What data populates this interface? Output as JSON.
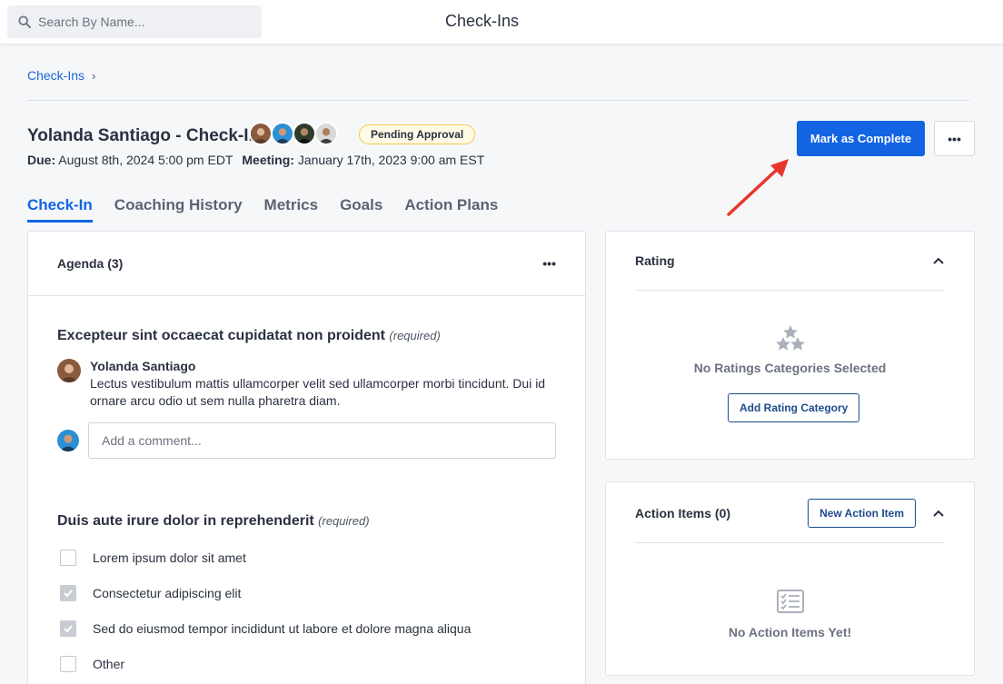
{
  "topbar": {
    "search_placeholder": "Search By Name...",
    "title": "Check-Ins"
  },
  "breadcrumb": {
    "root": "Check-Ins",
    "separator": "›"
  },
  "header": {
    "title": "Yolanda Santiago - Check-In",
    "badge": "Pending Approval",
    "due_label": "Due:",
    "due_value": "August 8th, 2024 5:00 pm EDT",
    "meeting_label": "Meeting:",
    "meeting_value": "January 17th, 2023 9:00 am EST",
    "primary_button": "Mark as Complete",
    "more_button": "•••"
  },
  "tabs": [
    {
      "label": "Check-In",
      "active": true
    },
    {
      "label": "Coaching History",
      "active": false
    },
    {
      "label": "Metrics",
      "active": false
    },
    {
      "label": "Goals",
      "active": false
    },
    {
      "label": "Action Plans",
      "active": false
    }
  ],
  "agenda": {
    "title": "Agenda (3)",
    "more": "•••",
    "questions": [
      {
        "title": "Excepteur sint occaecat cupidatat non proident",
        "required": "(required)",
        "comment_author": "Yolanda Santiago",
        "comment_text": "Lectus vestibulum mattis ullamcorper velit sed ullamcorper morbi tincidunt. Dui id ornare arcu odio ut sem nulla pharetra diam.",
        "add_comment_placeholder": "Add a comment..."
      },
      {
        "title": "Duis aute irure dolor in reprehenderit",
        "required": "(required)",
        "options": [
          {
            "label": "Lorem ipsum dolor sit amet",
            "checked": false
          },
          {
            "label": "Consectetur adipiscing elit",
            "checked": true
          },
          {
            "label": "Sed do eiusmod tempor incididunt ut labore et dolore magna aliqua",
            "checked": true
          },
          {
            "label": "Other",
            "checked": false
          }
        ]
      }
    ]
  },
  "rating": {
    "title": "Rating",
    "empty_text": "No Ratings Categories Selected",
    "add_button": "Add Rating Category"
  },
  "action_items": {
    "title": "Action Items (0)",
    "new_button": "New Action Item",
    "empty_text": "No Action Items Yet!"
  },
  "colors": {
    "primary": "#1264e3",
    "badge_border": "#f2c94c",
    "arrow": "#e8362a"
  },
  "icons": {
    "search": "search-icon",
    "stars": "stars-icon",
    "checklist": "checklist-icon",
    "chevron": "chevron-up-icon"
  }
}
